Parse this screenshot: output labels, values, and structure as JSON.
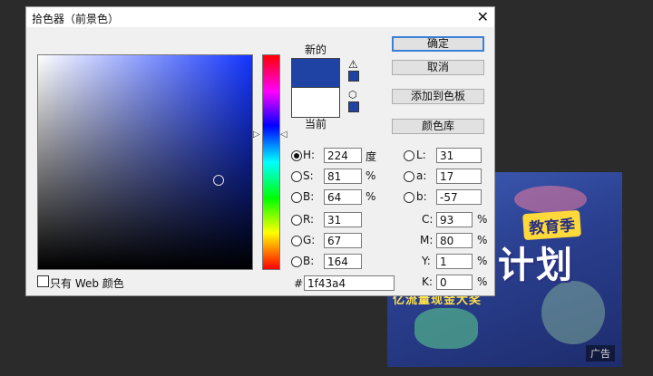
{
  "dialog": {
    "title": "拾色器（前景色）",
    "new_label": "新的",
    "current_label": "当前",
    "buttons": {
      "ok": "确定",
      "cancel": "取消",
      "add_to_swatches": "添加到色板",
      "color_libraries": "颜色库"
    },
    "colors": {
      "new": "#1f43a4",
      "current": "#ffffff"
    },
    "hsb": {
      "h": {
        "label": "H:",
        "value": "224",
        "unit": "度"
      },
      "s": {
        "label": "S:",
        "value": "81",
        "unit": "%"
      },
      "b": {
        "label": "B:",
        "value": "64",
        "unit": "%"
      }
    },
    "rgb": {
      "r": {
        "label": "R:",
        "value": "31"
      },
      "g": {
        "label": "G:",
        "value": "67"
      },
      "b": {
        "label": "B:",
        "value": "164"
      }
    },
    "lab": {
      "l": {
        "label": "L:",
        "value": "31"
      },
      "a": {
        "label": "a:",
        "value": "17"
      },
      "b": {
        "label": "b:",
        "value": "-57"
      }
    },
    "cmyk": {
      "c": {
        "label": "C:",
        "value": "93",
        "unit": "%"
      },
      "m": {
        "label": "M:",
        "value": "80",
        "unit": "%"
      },
      "y": {
        "label": "Y:",
        "value": "1",
        "unit": "%"
      },
      "k": {
        "label": "K:",
        "value": "0",
        "unit": "%"
      }
    },
    "hex": {
      "label": "#",
      "value": "1f43a4"
    },
    "web_only_label": "只有 Web 颜色"
  },
  "ad": {
    "label1": "教育季",
    "label2": "计划",
    "subtitle": "亿流量现金大奖",
    "tag": "广告"
  }
}
